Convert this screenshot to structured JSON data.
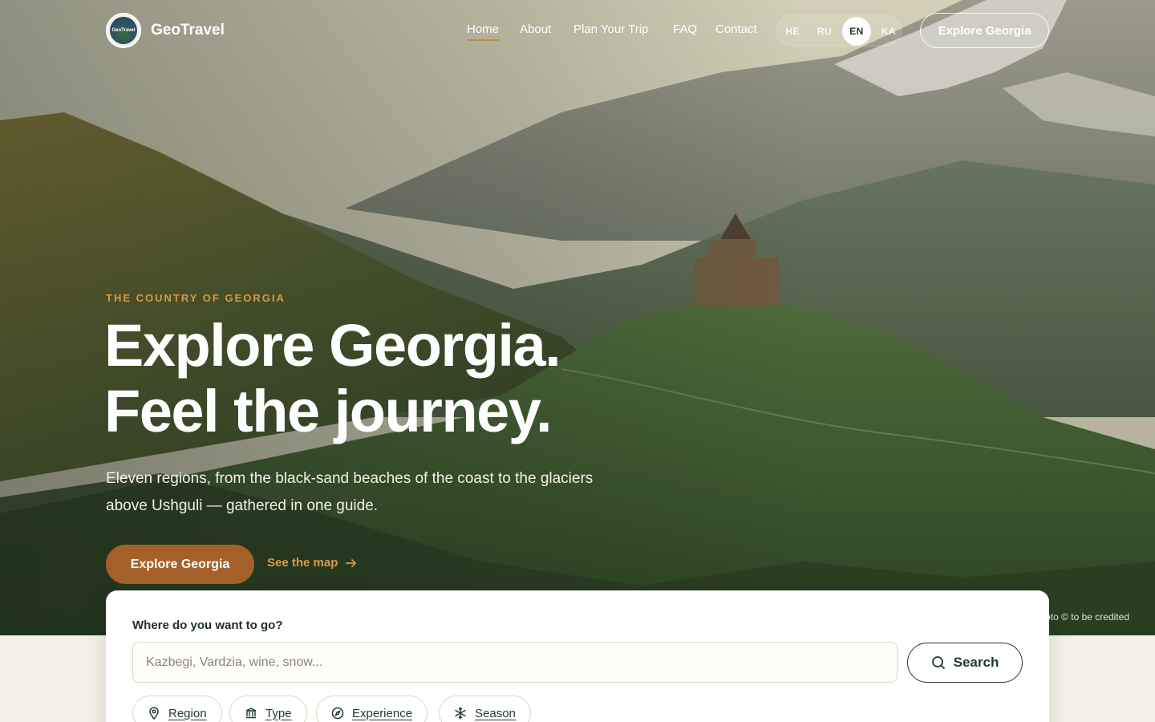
{
  "brand": {
    "name": "GeoTravel",
    "logo_text": "GeoTravel"
  },
  "nav": {
    "items": [
      {
        "label": "Home",
        "active": true
      },
      {
        "label": "About",
        "active": false
      },
      {
        "label": "Plan Your Trip",
        "active": false
      },
      {
        "label": "FAQ",
        "active": false
      },
      {
        "label": "Contact",
        "active": false
      }
    ]
  },
  "languages": {
    "items": [
      "HE",
      "RU",
      "EN",
      "KA"
    ],
    "selected": "EN"
  },
  "header": {
    "cta_label": "Explore Georgia"
  },
  "hero": {
    "eyebrow": "THE COUNTRY OF GEORGIA",
    "title_line1": "Explore Georgia.",
    "title_line2": "Feel the journey.",
    "lead": "Eleven regions, from the black-sand beaches of the coast to the glaciers above Ushguli — gathered in one guide.",
    "primary_cta": "Explore Georgia",
    "secondary_cta": "See the map",
    "photo_credit": "Photo © to be credited"
  },
  "search": {
    "label": "Where do you want to go?",
    "placeholder": "Kazbegi, Vardzia, wine, snow...",
    "value": "",
    "button_label": "Search",
    "filters": [
      {
        "label": "Region",
        "icon": "map-pin-icon"
      },
      {
        "label": "Type",
        "icon": "landmark-icon"
      },
      {
        "label": "Experience",
        "icon": "compass-icon"
      },
      {
        "label": "Season",
        "icon": "snowflake-icon"
      }
    ]
  },
  "colors": {
    "accent": "#a5602a",
    "accent_light": "#d79a45",
    "dark_green": "#1f3a2a",
    "page_bg": "#f5f1e6"
  }
}
